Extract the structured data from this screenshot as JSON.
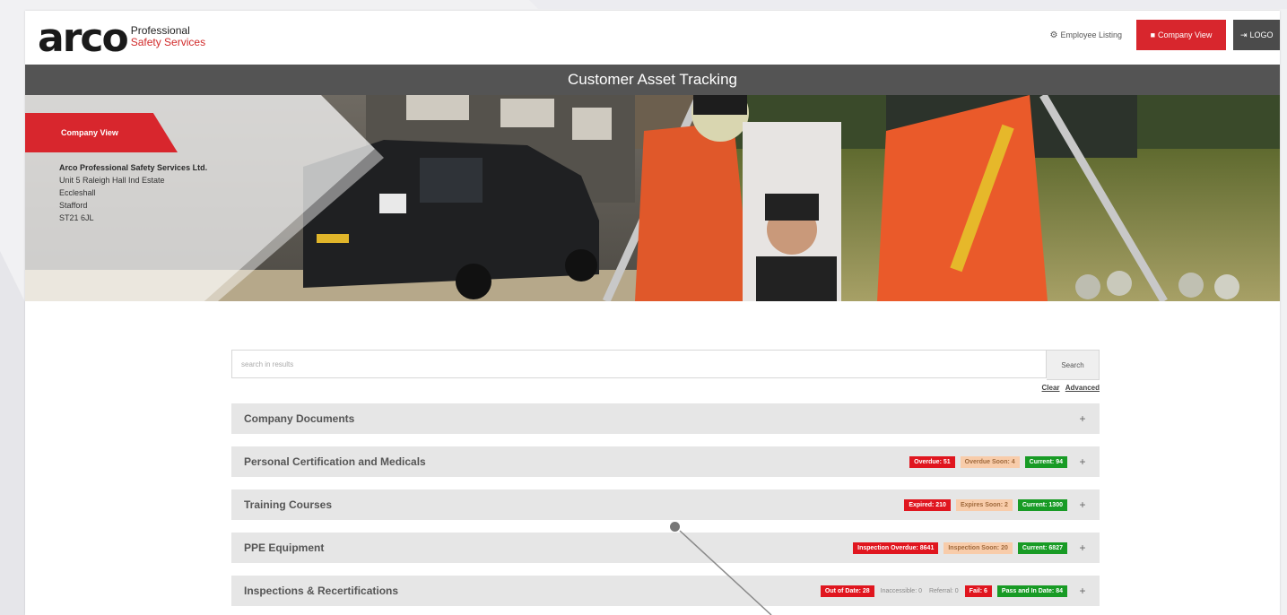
{
  "brand": {
    "logo_word": "arco",
    "logo_line1": "Professional",
    "logo_line2": "Safety Services",
    "accent_color": "#d8262d"
  },
  "nav": {
    "employee_listing": "Employee Listing",
    "company_view": "Company View",
    "logout": "LOGO"
  },
  "page": {
    "title": "Customer Asset Tracking"
  },
  "hero": {
    "ribbon_label": "Company View",
    "company_name": "Arco Professional Safety Services Ltd.",
    "address_lines": [
      "Unit 5 Raleigh Hall Ind Estate",
      "Eccleshall",
      "Stafford",
      "ST21 6JL"
    ]
  },
  "search": {
    "placeholder": "search in results",
    "button_label": "Search",
    "clear_label": "Clear",
    "advanced_label": "Advanced"
  },
  "sections": [
    {
      "title": "Company Documents",
      "badges": []
    },
    {
      "title": "Personal Certification and Medicals",
      "badges": [
        {
          "text": "Overdue: 51",
          "style": "red"
        },
        {
          "text": "Overdue Soon: 4",
          "style": "amber"
        },
        {
          "text": "Current: 94",
          "style": "green"
        }
      ]
    },
    {
      "title": "Training Courses",
      "badges": [
        {
          "text": "Expired: 210",
          "style": "red"
        },
        {
          "text": "Expires Soon: 2",
          "style": "amber"
        },
        {
          "text": "Current: 1300",
          "style": "green"
        }
      ]
    },
    {
      "title": "PPE Equipment",
      "badges": [
        {
          "text": "Inspection Overdue: 8641",
          "style": "red"
        },
        {
          "text": "Inspection Soon: 20",
          "style": "amber"
        },
        {
          "text": "Current: 6827",
          "style": "green"
        }
      ]
    },
    {
      "title": "Inspections & Recertifications",
      "badges": [
        {
          "text": "Out of Date: 28",
          "style": "red"
        },
        {
          "text": "Inaccessible: 0",
          "style": "plain"
        },
        {
          "text": "Referral: 0",
          "style": "plain"
        },
        {
          "text": "Fail: 6",
          "style": "red"
        },
        {
          "text": "Pass and In Date: 84",
          "style": "green"
        }
      ]
    }
  ],
  "expand_symbol": "+",
  "icons": {
    "employee": "users-icon",
    "company": "building-icon",
    "logout": "logout-icon"
  }
}
